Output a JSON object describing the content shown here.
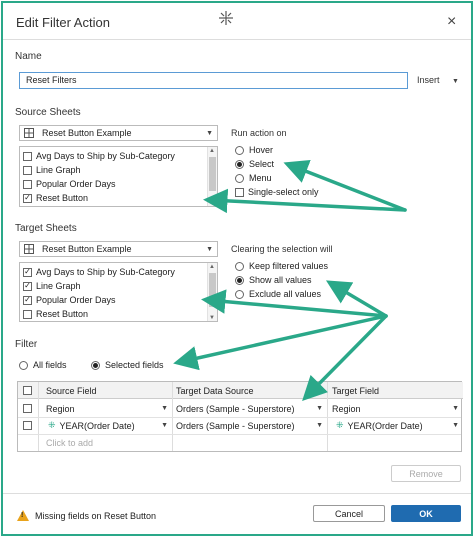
{
  "dialog": {
    "title": "Edit Filter Action",
    "close_glyph": "×",
    "accent": "#2aa889"
  },
  "name_section": {
    "label": "Name",
    "value": "Reset Filters",
    "insert_label": "Insert"
  },
  "source_sheets": {
    "label": "Source Sheets",
    "selected": "Reset Button Example",
    "items": [
      {
        "label": "Avg Days to Ship by Sub-Category",
        "checked": false
      },
      {
        "label": "Line Graph",
        "checked": false
      },
      {
        "label": "Popular Order Days",
        "checked": false
      },
      {
        "label": "Reset Button",
        "checked": true
      }
    ]
  },
  "run_action": {
    "label": "Run action on",
    "options": [
      {
        "label": "Hover",
        "selected": false
      },
      {
        "label": "Select",
        "selected": true
      },
      {
        "label": "Menu",
        "selected": false
      }
    ],
    "single_select_label": "Single-select only",
    "single_select_checked": false
  },
  "target_sheets": {
    "label": "Target Sheets",
    "selected": "Reset Button Example",
    "items": [
      {
        "label": "Avg Days to Ship by Sub-Category",
        "checked": true
      },
      {
        "label": "Line Graph",
        "checked": true
      },
      {
        "label": "Popular Order Days",
        "checked": true
      },
      {
        "label": "Reset Button",
        "checked": false
      }
    ]
  },
  "clearing": {
    "label": "Clearing the selection will",
    "options": [
      {
        "label": "Keep filtered values",
        "selected": false
      },
      {
        "label": "Show all values",
        "selected": true
      },
      {
        "label": "Exclude all values",
        "selected": false
      }
    ]
  },
  "filter": {
    "label": "Filter",
    "all_fields_label": "All fields",
    "selected_fields_label": "Selected fields",
    "columns": [
      "Source Field",
      "Target Data Source",
      "Target Field"
    ],
    "rows": [
      {
        "source": "Region",
        "source_icon": "",
        "target_source": "Orders (Sample - Superstore)",
        "target_field": "Region",
        "target_icon": ""
      },
      {
        "source": "YEAR(Order Date)",
        "source_icon": "⁜",
        "target_source": "Orders (Sample - Superstore)",
        "target_field": "YEAR(Order Date)",
        "target_icon": "⁜"
      }
    ],
    "add_placeholder": "Click to add"
  },
  "buttons": {
    "remove": "Remove",
    "cancel": "Cancel",
    "ok": "OK",
    "primary_color": "#1f6bb0"
  },
  "warning": {
    "text": "Missing fields on Reset Button",
    "icon": "warning-icon"
  }
}
